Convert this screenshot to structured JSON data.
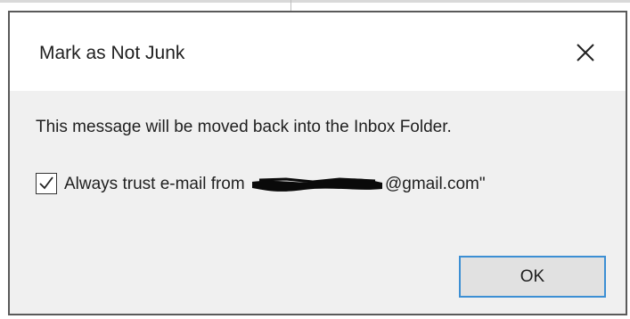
{
  "dialog": {
    "title": "Mark as Not Junk",
    "close_icon": "close-icon",
    "message": "This message will be moved back into the Inbox Folder.",
    "checkbox": {
      "checked": true,
      "label_prefix": "Always trust e-mail from ",
      "label_suffix": "@gmail.com\""
    },
    "ok_label": "OK"
  },
  "colors": {
    "dialog_background": "#f0f0f0",
    "titlebar_background": "#ffffff",
    "button_border_accent": "#3c8fd4",
    "button_background": "#e1e1e1"
  }
}
